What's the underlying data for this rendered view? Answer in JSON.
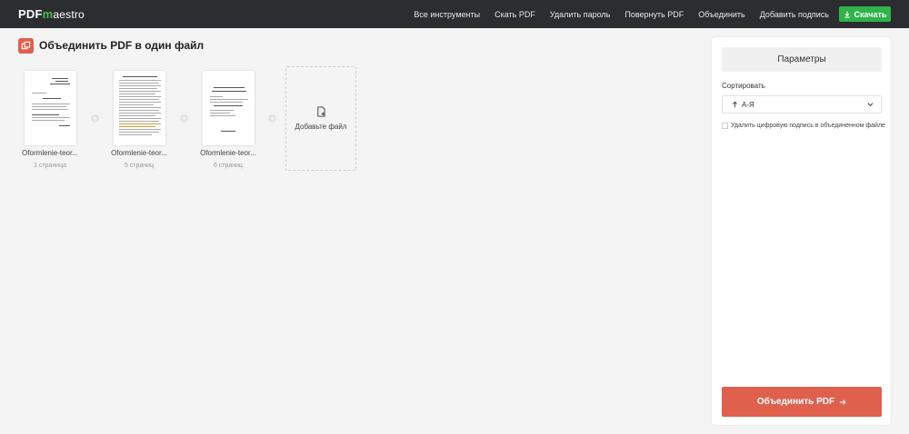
{
  "header": {
    "logo_pdf": "PDF",
    "logo_m": "m",
    "logo_rest": "aestro",
    "nav": [
      {
        "label": "Все инструменты"
      },
      {
        "label": "Скать PDF"
      },
      {
        "label": "Удалить пароль"
      },
      {
        "label": "Повернуть PDF"
      },
      {
        "label": "Объединить"
      },
      {
        "label": "Добавить подпись"
      }
    ],
    "download_label": "Скачать"
  },
  "page": {
    "title": "Объединить PDF в один файл"
  },
  "files": [
    {
      "name": "Oformlenie-teor...",
      "pages": "1 страница"
    },
    {
      "name": "Oformlenie-teor...",
      "pages": "5 страниц"
    },
    {
      "name": "Oformlenie-teor...",
      "pages": "6 страниц"
    }
  ],
  "add_file": {
    "label": "Добавьте файл"
  },
  "panel": {
    "title": "Параметры",
    "sort_label": "Сортировать",
    "sort_value": "А-Я",
    "remove_signature_label": "Удалить цифровую подпись в объединенном файле",
    "merge_label": "Объединить PDF"
  },
  "colors": {
    "topbar": "#2b2d30",
    "accent_green": "#2fb34a",
    "accent_red": "#e0604e",
    "background": "#f4f4f4"
  },
  "icons": {
    "download": "download-icon",
    "title": "copy-icon",
    "add_file": "file-add-icon",
    "separator": "plus-icon",
    "sort": "arrow-up-icon",
    "dropdown": "chevron-down-icon",
    "merge": "arrow-right-icon"
  }
}
